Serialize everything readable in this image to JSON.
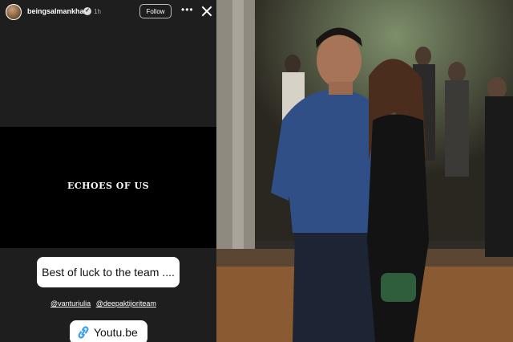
{
  "story": {
    "username": "beingsalmankhan",
    "time": "1h",
    "follow_label": "Follow",
    "more_label": "•••",
    "card_title": "ECHOES OF US",
    "caption": "Best of luck to the team ....",
    "mentions": [
      "@vanturiulia",
      "@deepaktijoriteam"
    ],
    "link_label": "Youtu.be"
  },
  "colors": {
    "story_bg": "#1e1e1e",
    "card_bg": "#000000",
    "sticker_bg": "#ffffff",
    "link_icon": "#3aa0e8"
  }
}
